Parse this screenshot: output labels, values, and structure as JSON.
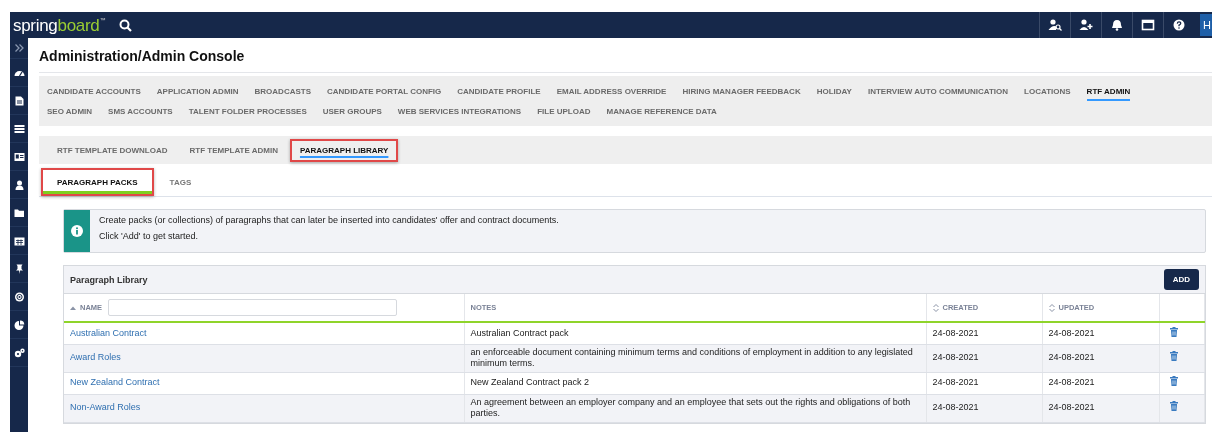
{
  "top_bar": {
    "logo": {
      "part_1": "spring",
      "part_2": "board",
      "mark": "™"
    },
    "actions": [
      {
        "kind": "user-search"
      },
      {
        "kind": "user-add"
      },
      {
        "kind": "bell"
      },
      {
        "kind": "window"
      },
      {
        "kind": "help"
      }
    ],
    "user_button": "H"
  },
  "sidebar": {
    "items": [
      {
        "kind": "expand"
      },
      {
        "kind": "gauge"
      },
      {
        "kind": "document"
      },
      {
        "kind": "list"
      },
      {
        "kind": "card"
      },
      {
        "kind": "user"
      },
      {
        "kind": "folder"
      },
      {
        "kind": "calendar"
      },
      {
        "kind": "pin"
      },
      {
        "kind": "target"
      },
      {
        "kind": "pie"
      },
      {
        "kind": "gears"
      }
    ]
  },
  "page_title": "Administration/Admin Console",
  "main_tabs": [
    {
      "label": "CANDIDATE ACCOUNTS",
      "selected": false
    },
    {
      "label": "APPLICATION ADMIN",
      "selected": false
    },
    {
      "label": "BROADCASTS",
      "selected": false
    },
    {
      "label": "CANDIDATE PORTAL CONFIG",
      "selected": false
    },
    {
      "label": "CANDIDATE PROFILE",
      "selected": false
    },
    {
      "label": "EMAIL ADDRESS OVERRIDE",
      "selected": false
    },
    {
      "label": "HIRING MANAGER FEEDBACK",
      "selected": false
    },
    {
      "label": "HOLIDAY",
      "selected": false
    },
    {
      "label": "INTERVIEW AUTO COMMUNICATION",
      "selected": false
    },
    {
      "label": "LOCATIONS",
      "selected": false
    },
    {
      "label": "RTF ADMIN",
      "selected": true
    },
    {
      "label": "SEO ADMIN",
      "selected": false
    },
    {
      "label": "SMS ACCOUNTS",
      "selected": false
    },
    {
      "label": "TALENT FOLDER PROCESSES",
      "selected": false
    },
    {
      "label": "USER GROUPS",
      "selected": false
    },
    {
      "label": "WEB SERVICES INTEGRATIONS",
      "selected": false
    },
    {
      "label": "FILE UPLOAD",
      "selected": false
    },
    {
      "label": "MANAGE REFERENCE DATA",
      "selected": false
    }
  ],
  "sub_tabs": [
    {
      "label": "RTF TEMPLATE DOWNLOAD",
      "selected": false,
      "highlighted": false
    },
    {
      "label": "RTF TEMPLATE ADMIN",
      "selected": false,
      "highlighted": false
    },
    {
      "label": "PARAGRAPH LIBRARY",
      "selected": true,
      "highlighted": true
    }
  ],
  "section_tabs": [
    {
      "label": "PARAGRAPH PACKS",
      "selected": true,
      "highlighted": true
    },
    {
      "label": "TAGS",
      "selected": false,
      "highlighted": false
    }
  ],
  "info": {
    "lines": [
      "Create packs (or collections) of paragraphs that can later be inserted into candidates' offer and contract documents.",
      "Click 'Add' to get started."
    ]
  },
  "panel": {
    "title": "Paragraph Library",
    "add_button": "ADD",
    "columns": [
      {
        "label": "NAME",
        "kind": "sorted"
      },
      {
        "label": "NOTES",
        "kind": "plain"
      },
      {
        "label": "CREATED",
        "kind": "sortable"
      },
      {
        "label": "UPDATED",
        "kind": "sortable"
      }
    ],
    "rows": [
      {
        "name": "Australian Contract",
        "notes": "Australian Contract pack",
        "created": "24-08-2021",
        "updated": "24-08-2021"
      },
      {
        "name": "Award Roles",
        "notes": "an enforceable document containing minimum terms and conditions of employment in addition to any legislated minimum terms.",
        "created": "24-08-2021",
        "updated": "24-08-2021"
      },
      {
        "name": "New Zealand Contract",
        "notes": "New Zealand Contract pack 2",
        "created": "24-08-2021",
        "updated": "24-08-2021"
      },
      {
        "name": "Non-Award Roles",
        "notes": "An agreement between an employer company and an employee that sets out the rights and obligations of both parties.",
        "created": "24-08-2021",
        "updated": "24-08-2021"
      }
    ]
  }
}
